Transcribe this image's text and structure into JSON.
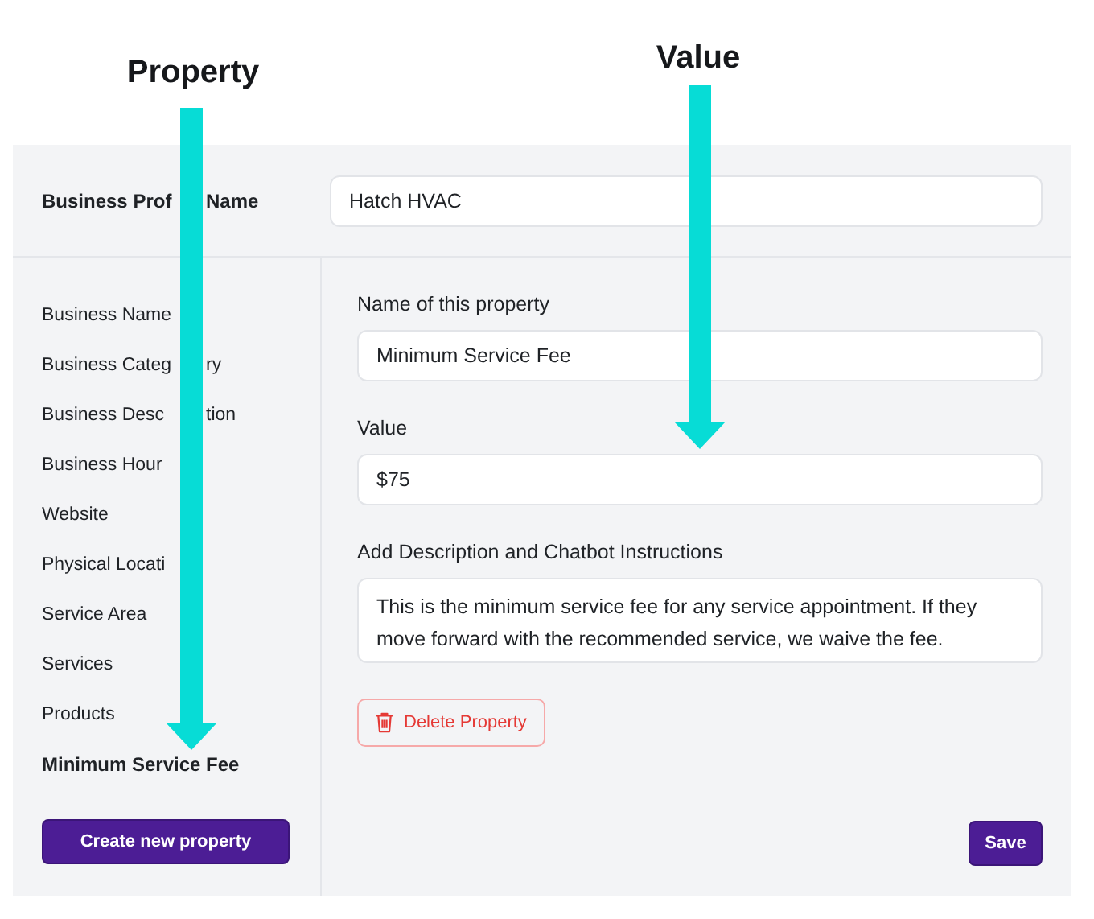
{
  "annotations": [
    {
      "label": "Property"
    },
    {
      "label": "Value"
    }
  ],
  "profile": {
    "label_before": "Business Prof",
    "label_after": "Name",
    "value": "Hatch HVAC"
  },
  "sidebar": {
    "items": [
      {
        "label": "Business Name",
        "selected": false
      },
      {
        "label": "Business Categ",
        "label_after": "ry",
        "selected": false
      },
      {
        "label": "Business Desc",
        "label_after": "tion",
        "selected": false
      },
      {
        "label": "Business Hour",
        "selected": false
      },
      {
        "label": "Website",
        "selected": false
      },
      {
        "label": "Physical Locati",
        "selected": false
      },
      {
        "label": "Service Area",
        "selected": false
      },
      {
        "label": "Services",
        "selected": false
      },
      {
        "label": "Products",
        "selected": false
      },
      {
        "label": "Minimum Service Fee",
        "selected": true
      }
    ],
    "create_button": "Create new property"
  },
  "form": {
    "fields": [
      {
        "label": "Name of this property",
        "value": "Minimum Service Fee",
        "kind": "input"
      },
      {
        "label": "Value",
        "value": "$75",
        "kind": "input"
      },
      {
        "label": "Add Description and Chatbot Instructions",
        "value": "This is the minimum service fee for any service appointment. If they move forward with the recommended service, we waive the fee.",
        "kind": "textarea"
      }
    ],
    "delete_button": "Delete Property",
    "save_button": "Save"
  }
}
